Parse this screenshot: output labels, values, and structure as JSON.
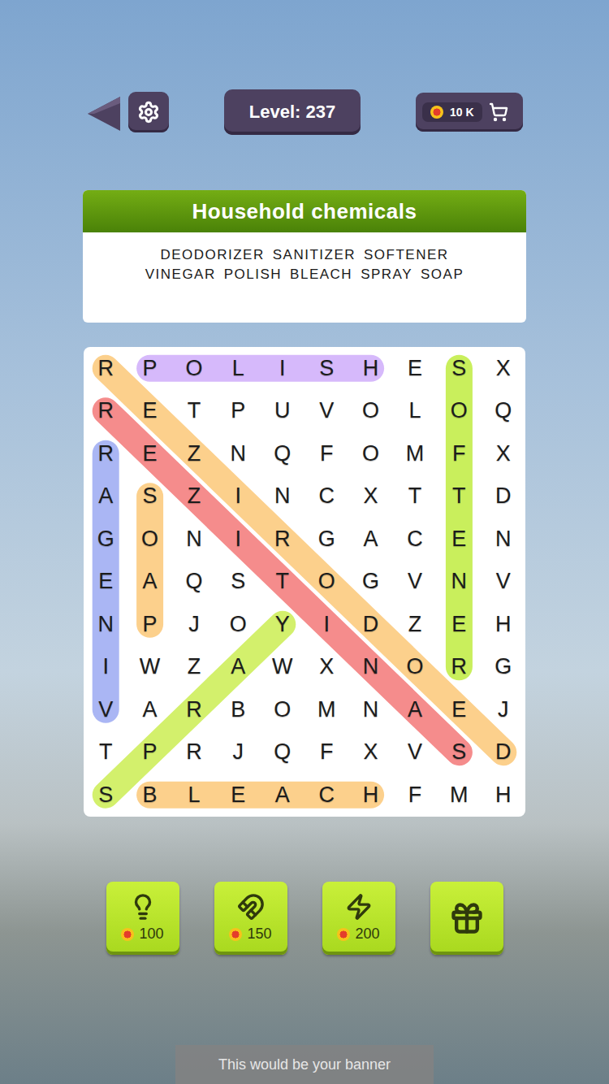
{
  "header": {
    "level_label": "Level: 237",
    "coins": "10 K"
  },
  "category": {
    "title": "Household chemicals",
    "words": [
      "DEODORIZER",
      "SANITIZER",
      "SOFTENER",
      "VINEGAR",
      "POLISH",
      "BLEACH",
      "SPRAY",
      "SOAP"
    ]
  },
  "grid": {
    "rows": [
      [
        "R",
        "P",
        "O",
        "L",
        "I",
        "S",
        "H",
        "E",
        "S",
        "X"
      ],
      [
        "R",
        "E",
        "T",
        "P",
        "U",
        "V",
        "O",
        "L",
        "O",
        "Q"
      ],
      [
        "R",
        "E",
        "Z",
        "N",
        "Q",
        "F",
        "O",
        "M",
        "F",
        "X"
      ],
      [
        "A",
        "S",
        "Z",
        "I",
        "N",
        "C",
        "X",
        "T",
        "T",
        "D"
      ],
      [
        "G",
        "O",
        "N",
        "I",
        "R",
        "G",
        "A",
        "C",
        "E",
        "N"
      ],
      [
        "E",
        "A",
        "Q",
        "S",
        "T",
        "O",
        "G",
        "V",
        "N",
        "V"
      ],
      [
        "N",
        "P",
        "J",
        "O",
        "Y",
        "I",
        "D",
        "Z",
        "E",
        "H"
      ],
      [
        "I",
        "W",
        "Z",
        "A",
        "W",
        "X",
        "N",
        "O",
        "R",
        "G"
      ],
      [
        "V",
        "A",
        "R",
        "B",
        "O",
        "M",
        "N",
        "A",
        "E",
        "J"
      ],
      [
        "T",
        "P",
        "R",
        "J",
        "Q",
        "F",
        "X",
        "V",
        "S",
        "D"
      ],
      [
        "S",
        "B",
        "L",
        "E",
        "A",
        "C",
        "H",
        "F",
        "M",
        "H"
      ]
    ],
    "highlights": [
      {
        "from": [
          0,
          1
        ],
        "to": [
          0,
          6
        ],
        "color": "#d6b9fb"
      },
      {
        "from": [
          0,
          8
        ],
        "to": [
          7,
          8
        ],
        "color": "#c9ef5c"
      },
      {
        "from": [
          2,
          0
        ],
        "to": [
          8,
          0
        ],
        "color": "#aab6f4"
      },
      {
        "from": [
          3,
          1
        ],
        "to": [
          6,
          1
        ],
        "color": "#fcd08c"
      },
      {
        "from": [
          10,
          1
        ],
        "to": [
          10,
          6
        ],
        "color": "#fcd08c"
      },
      {
        "from": [
          10,
          0
        ],
        "to": [
          6,
          4
        ],
        "color": "#d3f06c"
      },
      {
        "from": [
          0,
          0
        ],
        "to": [
          9,
          9
        ],
        "color": "#fcd08c"
      },
      {
        "from": [
          1,
          0
        ],
        "to": [
          9,
          8
        ],
        "color": "#f58c8c"
      }
    ]
  },
  "boosters": [
    {
      "kind": "hint",
      "price": "100"
    },
    {
      "kind": "magnet",
      "price": "150"
    },
    {
      "kind": "lightning",
      "price": "200"
    },
    {
      "kind": "video-gift"
    }
  ],
  "banner": "This would be your banner"
}
